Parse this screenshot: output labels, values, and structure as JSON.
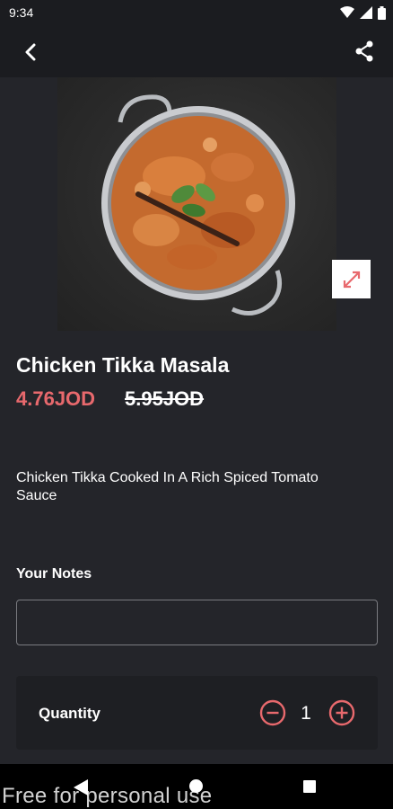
{
  "status_bar": {
    "time": "9:34"
  },
  "product": {
    "name": "Chicken Tikka Masala",
    "price_current": "4.76JOD",
    "price_original": "5.95JOD",
    "description": "Chicken Tikka Cooked In A Rich Spiced Tomato Sauce"
  },
  "notes": {
    "label": "Your Notes",
    "value": "",
    "placeholder": ""
  },
  "quantity": {
    "label": "Quantity",
    "value": "1"
  },
  "colors": {
    "accent": "#e8696d",
    "background": "#24252a",
    "card": "#1e1f23"
  },
  "icons": {
    "back": "back-arrow-icon",
    "share": "share-icon",
    "expand": "expand-icon",
    "minus": "minus-circle-icon",
    "plus": "plus-circle-icon"
  },
  "watermark": "Free for personal use"
}
